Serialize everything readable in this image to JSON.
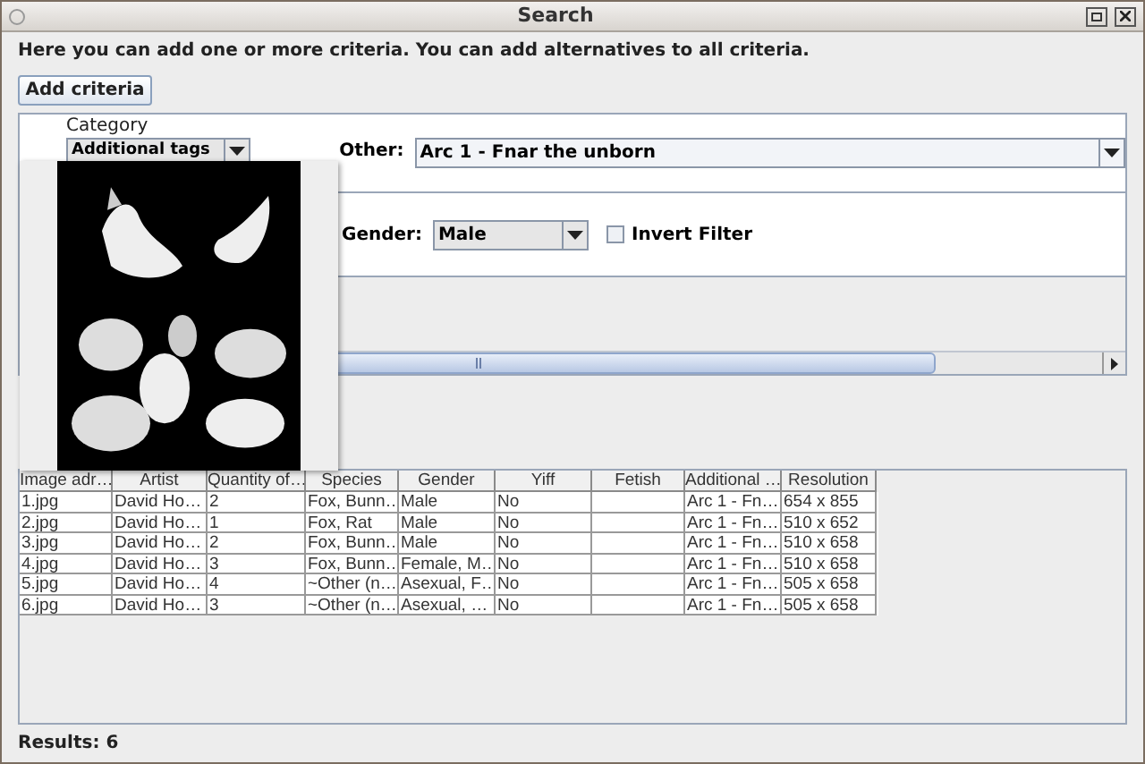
{
  "window": {
    "title": "Search"
  },
  "intro": "Here you can add one or more criteria. You can add alternatives to all criteria.",
  "add_button": "Add criteria",
  "criteria": {
    "category_label": "Category",
    "category_value": "Additional tags",
    "other_label": "Other:",
    "other_value": "Arc 1 - Fnar the unborn",
    "gender_label": "Gender:",
    "gender_value": "Male",
    "invert_label": "Invert Filter",
    "invert_checked": false
  },
  "table": {
    "columns": [
      "Image adr…",
      "Artist",
      "Quantity of…",
      "Species",
      "Gender",
      "Yiff",
      "Fetish",
      "Additional …",
      "Resolution"
    ],
    "rows": [
      [
        "1.jpg",
        "David Ho…",
        "2",
        "Fox, Bunn…",
        "Male",
        "No",
        "",
        "Arc 1 - Fn…",
        "654 x 855"
      ],
      [
        "2.jpg",
        "David Ho…",
        "1",
        "Fox, Rat",
        "Male",
        "No",
        "",
        "Arc 1 - Fn…",
        "510 x 652"
      ],
      [
        "3.jpg",
        "David Ho…",
        "2",
        "Fox, Bunn…",
        "Male",
        "No",
        "",
        "Arc 1 - Fn…",
        "510 x 658"
      ],
      [
        "4.jpg",
        "David Ho…",
        "3",
        "Fox, Bunn…",
        "Female, M…",
        "No",
        "",
        "Arc 1 - Fn…",
        "510 x 658"
      ],
      [
        "5.jpg",
        "David Ho…",
        "4",
        "~Other (n…",
        "Asexual, F…",
        "No",
        "",
        "Arc 1 - Fn…",
        "505 x 658"
      ],
      [
        "6.jpg",
        "David Ho…",
        "3",
        "~Other (n…",
        "Asexual, …",
        "No",
        "",
        "Arc 1 - Fn…",
        "505 x 658"
      ]
    ]
  },
  "status": "Results: 6"
}
